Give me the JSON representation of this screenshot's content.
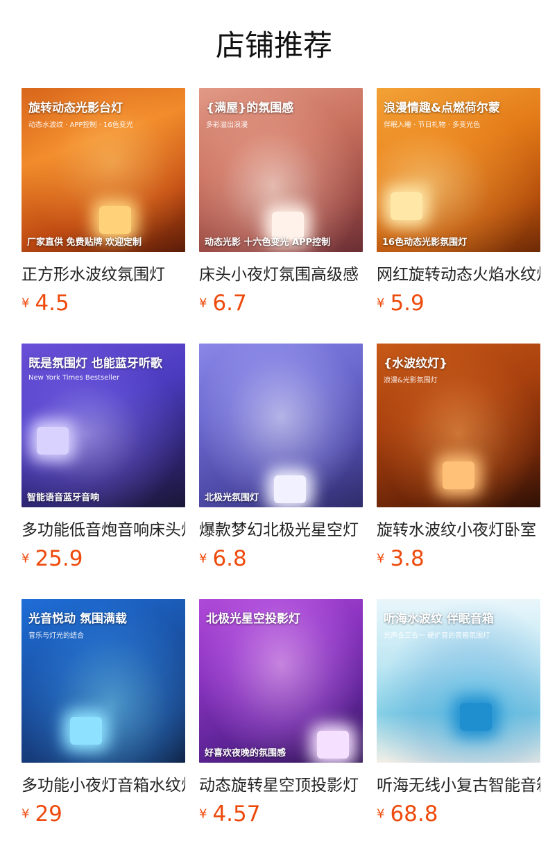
{
  "page": {
    "title": "店铺推荐",
    "currency_symbol": "¥",
    "accent_color": "#ee4a0c"
  },
  "products": [
    {
      "name": "正方形水波纹氛围灯",
      "price": "4.5",
      "image": {
        "text1": "旋转动态光影台灯",
        "text2": "动态水波纹 · APP控制 · 16色变光",
        "text3": "厂家直供 免费贴牌 欢迎定制",
        "bg": "linear-gradient(160deg,#d9661c 0%,#f08a2a 35%,#c04a12 70%,#5a1c08 100%)",
        "glow": "radial-gradient(ellipse at 55% 45%,rgba(255,200,110,0.55) 0%,rgba(255,160,60,0.2) 45%,rgba(0,0,0,0) 70%)",
        "lamp": "#ffd27a"
      }
    },
    {
      "name": "床头小夜灯氛围高级感",
      "price": "6.7",
      "image": {
        "text1": "{满屋}的氛围感",
        "text2": "多彩溢出浪漫",
        "text3": "动态光影 十六色变光 APP控制",
        "bg": "linear-gradient(160deg,#e29a86 0%,#c8705e 40%,#9a4a44 75%,#6a2e34 100%)",
        "glow": "radial-gradient(ellipse at 45% 60%,rgba(255,235,225,0.65) 0%,rgba(255,190,170,0.25) 40%,rgba(0,0,0,0) 70%)",
        "lamp": "#fff2ea"
      }
    },
    {
      "name": "网红旋转动态火焰水纹灯",
      "price": "5.9",
      "image": {
        "text1": "浪漫情趣&点燃荷尔蒙",
        "text2": "伴眠入睡 · 节日礼物 · 多变光色",
        "text3": "16色动态光影氛围灯",
        "bg": "linear-gradient(160deg,#f3a236 0%,#e37a18 40%,#b44e0c 75%,#6d2a06 100%)",
        "glow": "radial-gradient(ellipse at 30% 60%,rgba(255,225,150,0.6) 0%,rgba(255,170,60,0.25) 40%,rgba(0,0,0,0) 70%)",
        "lamp": "#ffe7a8"
      }
    },
    {
      "name": "多功能低音炮音响床头灯",
      "price": "25.9",
      "image": {
        "text1": "既是氛围灯 也能蓝牙听歌",
        "text2": "New York Times Bestseller",
        "text3": "智能语音蓝牙音响",
        "bg": "linear-gradient(160deg,#6a50d8 0%,#4a3bbf 40%,#2c236f 75%,#1a1736 100%)",
        "glow": "radial-gradient(ellipse at 40% 55%,rgba(200,190,255,0.55) 0%,rgba(140,120,255,0.25) 40%,rgba(0,0,0,0) 70%)",
        "lamp": "#d9d2ff"
      }
    },
    {
      "name": "爆款梦幻北极光星空灯",
      "price": "6.8",
      "image": {
        "text1": "",
        "text2": "",
        "text3": "北极光氛围灯",
        "bg": "linear-gradient(160deg,#8a87e8 0%,#6c69cf 35%,#4e4aa8 70%,#2f2c6a 100%)",
        "glow": "radial-gradient(ellipse at 50% 45%,rgba(235,235,255,0.6) 0%,rgba(190,190,255,0.25) 45%,rgba(0,0,0,0) 72%)",
        "lamp": "#f1f1ff"
      }
    },
    {
      "name": "旋转水波纹小夜灯卧室",
      "price": "3.8",
      "image": {
        "text1": "{水波纹灯}",
        "text2": "浪漫&光影氛围灯",
        "text3": "",
        "bg": "linear-gradient(160deg,#c85a18 0%,#a8400e 40%,#6e2608 75%,#2e1006 100%)",
        "glow": "radial-gradient(ellipse at 50% 55%,rgba(255,170,90,0.55) 0%,rgba(220,110,40,0.25) 45%,rgba(0,0,0,0) 70%)",
        "lamp": "#ffc078"
      }
    },
    {
      "name": "多功能小夜灯音箱水纹灯",
      "price": "29",
      "image": {
        "text1": "光音悦动 氛围满载",
        "text2": "音乐与灯光的结合",
        "text3": "",
        "bg": "linear-gradient(160deg,#1e6ed8 0%,#1a53a8 40%,#163a78 75%,#0e1f40 100%)",
        "glow": "radial-gradient(ellipse at 55% 65%,rgba(120,220,255,0.55) 0%,rgba(60,160,255,0.25) 45%,rgba(0,0,0,0) 72%)",
        "lamp": "#8fe2ff"
      }
    },
    {
      "name": "动态旋转星空顶投影灯",
      "price": "4.57",
      "image": {
        "text1": "北极光星空投影灯",
        "text2": "",
        "text3": "好喜欢夜晚的氛围感",
        "bg": "linear-gradient(160deg,#b04ad8 0%,#8a34c0 35%,#5e2496 70%,#2e1450 100%)",
        "glow": "radial-gradient(ellipse at 50% 40%,rgba(255,200,255,0.55) 0%,rgba(220,130,255,0.25) 45%,rgba(0,0,0,0) 72%)",
        "lamp": "#f5e1ff"
      }
    },
    {
      "name": "听海无线小复古智能音箱",
      "price": "68.8",
      "image": {
        "text1": "听海水波纹 伴眠音箱",
        "text2": "光声合三合一 硬扩音的音箱氛围灯",
        "text3": "",
        "bg": "linear-gradient(180deg,#e9f6fb 0%,#bfe7f3 40%,#86d0e6 70%,#f3efe6 100%)",
        "glow": "radial-gradient(ellipse at 60% 70%,rgba(40,160,220,0.45) 0%,rgba(20,120,200,0.2) 40%,rgba(0,0,0,0) 70%)",
        "lamp": "#1f8fd0"
      }
    }
  ]
}
